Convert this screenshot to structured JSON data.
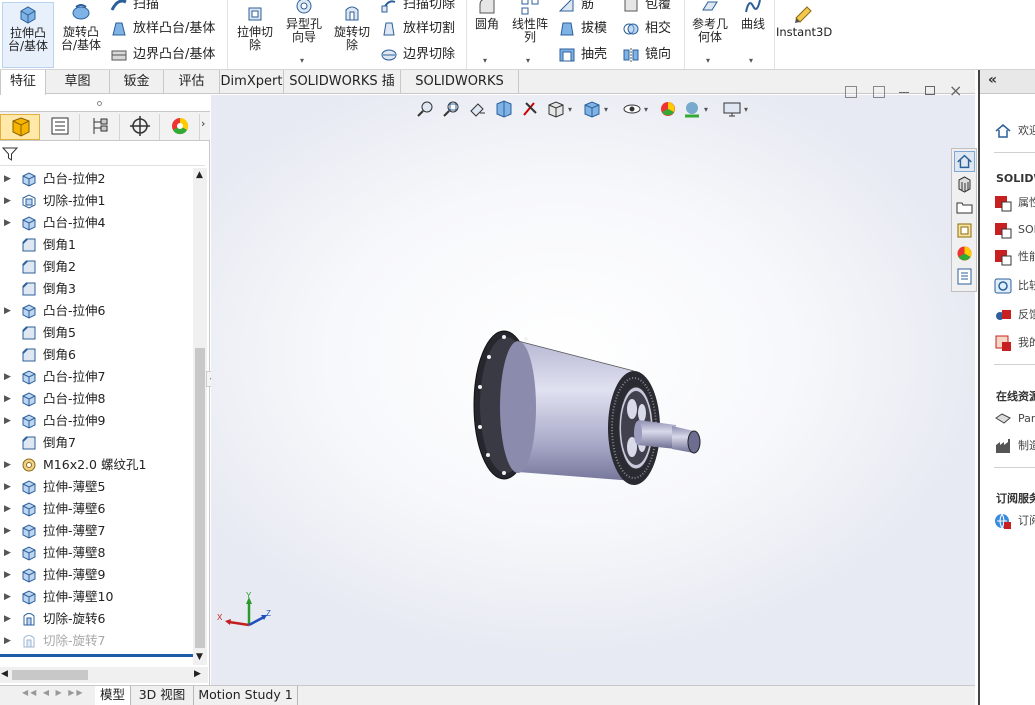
{
  "ribbon": {
    "extrude_boss": "拉伸凸\n台/基体",
    "revolve_boss": "旋转凸\n台/基体",
    "sweep": "扫描",
    "loft_boss": "放样凸台/基体",
    "boundary_boss": "边界凸台/基体",
    "extrude_cut": "拉伸切\n除",
    "hole_wizard": "异型孔\n向导",
    "revolve_cut": "旋转切\n除",
    "swept_cut": "扫描切除",
    "lofted_cut": "放样切割",
    "boundary_cut": "边界切除",
    "fillet": "圆角",
    "linear_pattern": "线性阵\n列",
    "rib": "筋",
    "draft": "拔模",
    "shell": "抽壳",
    "wrap": "包覆",
    "intersect": "相交",
    "mirror": "镜向",
    "ref_geometry": "参考几\n何体",
    "curves": "曲线",
    "instant3d": "Instant3D"
  },
  "cm_tabs": [
    "特征",
    "草图",
    "钣金",
    "评估",
    "DimXpert",
    "SOLIDWORKS 插件",
    "SOLIDWORKS MBD"
  ],
  "tree": [
    {
      "label": "凸台-拉伸2",
      "icon": "extrude-icon",
      "arrow": true,
      "dim": false
    },
    {
      "label": "切除-拉伸1",
      "icon": "cut-extrude-icon",
      "arrow": true,
      "dim": false
    },
    {
      "label": "凸台-拉伸4",
      "icon": "extrude-icon",
      "arrow": true,
      "dim": false
    },
    {
      "label": "倒角1",
      "icon": "chamfer-icon",
      "arrow": false,
      "dim": false
    },
    {
      "label": "倒角2",
      "icon": "chamfer-icon",
      "arrow": false,
      "dim": false
    },
    {
      "label": "倒角3",
      "icon": "chamfer-icon",
      "arrow": false,
      "dim": false
    },
    {
      "label": "凸台-拉伸6",
      "icon": "extrude-icon",
      "arrow": true,
      "dim": false
    },
    {
      "label": "倒角5",
      "icon": "chamfer-icon",
      "arrow": false,
      "dim": false
    },
    {
      "label": "倒角6",
      "icon": "chamfer-icon",
      "arrow": false,
      "dim": false
    },
    {
      "label": "凸台-拉伸7",
      "icon": "extrude-icon",
      "arrow": true,
      "dim": false
    },
    {
      "label": "凸台-拉伸8",
      "icon": "extrude-icon",
      "arrow": true,
      "dim": false
    },
    {
      "label": "凸台-拉伸9",
      "icon": "extrude-icon",
      "arrow": true,
      "dim": false
    },
    {
      "label": "倒角7",
      "icon": "chamfer-icon",
      "arrow": false,
      "dim": false
    },
    {
      "label": "M16x2.0 螺纹孔1",
      "icon": "hole-icon",
      "arrow": true,
      "dim": false
    },
    {
      "label": "拉伸-薄壁5",
      "icon": "extrude-icon",
      "arrow": true,
      "dim": false
    },
    {
      "label": "拉伸-薄壁6",
      "icon": "extrude-icon",
      "arrow": true,
      "dim": false
    },
    {
      "label": "拉伸-薄壁7",
      "icon": "extrude-icon",
      "arrow": true,
      "dim": false
    },
    {
      "label": "拉伸-薄壁8",
      "icon": "extrude-icon",
      "arrow": true,
      "dim": false
    },
    {
      "label": "拉伸-薄壁9",
      "icon": "extrude-icon",
      "arrow": true,
      "dim": false
    },
    {
      "label": "拉伸-薄壁10",
      "icon": "extrude-icon",
      "arrow": true,
      "dim": false
    },
    {
      "label": "切除-旋转6",
      "icon": "revolve-cut-icon",
      "arrow": true,
      "dim": false
    },
    {
      "label": "切除-旋转7",
      "icon": "revolve-cut-icon",
      "arrow": true,
      "dim": true
    }
  ],
  "bottom_tabs": [
    "模型",
    "3D 视图",
    "Motion Study 1"
  ],
  "triad": {
    "x": "X",
    "y": "Y",
    "z": "Z"
  },
  "taskpane": {
    "welcome": "欢迎",
    "section_solidworks": "SOLIDW",
    "items1": [
      "属性",
      "SOL",
      "性能",
      "比较",
      "反馈",
      "我的"
    ],
    "section_online": "在线资源",
    "items2": [
      "Par",
      "制造"
    ],
    "section_subscription": "订阅服务",
    "items3": [
      "订阅"
    ]
  }
}
